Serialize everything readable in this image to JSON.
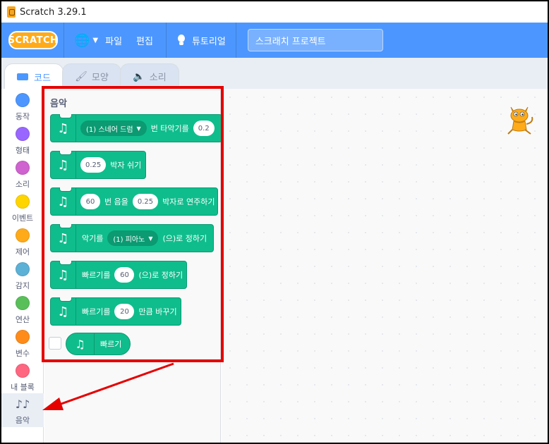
{
  "window": {
    "title": "Scratch 3.29.1"
  },
  "menubar": {
    "logo": "SCRATCH",
    "file": "파일",
    "edit": "편집",
    "tutorial": "튜토리얼",
    "project_title": "스크래치 프로젝트"
  },
  "tabs": {
    "code": "코드",
    "costume": "모양",
    "sound": "소리"
  },
  "categories": [
    {
      "label": "동작",
      "color": "#4c97ff"
    },
    {
      "label": "형태",
      "color": "#9966ff"
    },
    {
      "label": "소리",
      "color": "#cf63cf"
    },
    {
      "label": "이벤트",
      "color": "#ffd500"
    },
    {
      "label": "제어",
      "color": "#ffab19"
    },
    {
      "label": "감지",
      "color": "#5cb1d6"
    },
    {
      "label": "연산",
      "color": "#59c059"
    },
    {
      "label": "변수",
      "color": "#ff8c1a"
    },
    {
      "label": "내 블록",
      "color": "#ff6680"
    },
    {
      "label": "음악",
      "icon": "music-notes-icon"
    }
  ],
  "palette": {
    "section_title": "음악",
    "blocks": {
      "b1_drum": "(1) 스네어 드럼",
      "b1_text": "번 타악기를",
      "b1_beats": "0.2",
      "b2_beats": "0.25",
      "b2_text": "박자 쉬기",
      "b3_note": "60",
      "b3_t1": "번 음을",
      "b3_beats": "0.25",
      "b3_t2": "박자로 연주하기",
      "b4_t1": "악기를",
      "b4_instr": "(1) 피아노",
      "b4_t2": "(으)로 정하기",
      "b5_t1": "빠르기를",
      "b5_val": "60",
      "b5_t2": "(으)로 정하기",
      "b6_t1": "빠르기를",
      "b6_val": "20",
      "b6_t2": "만큼 바꾸기",
      "reporter": "빠르기"
    }
  },
  "colors": {
    "accent": "#4c97ff",
    "music_block": "#0fbd8c",
    "highlight": "#e60000"
  }
}
